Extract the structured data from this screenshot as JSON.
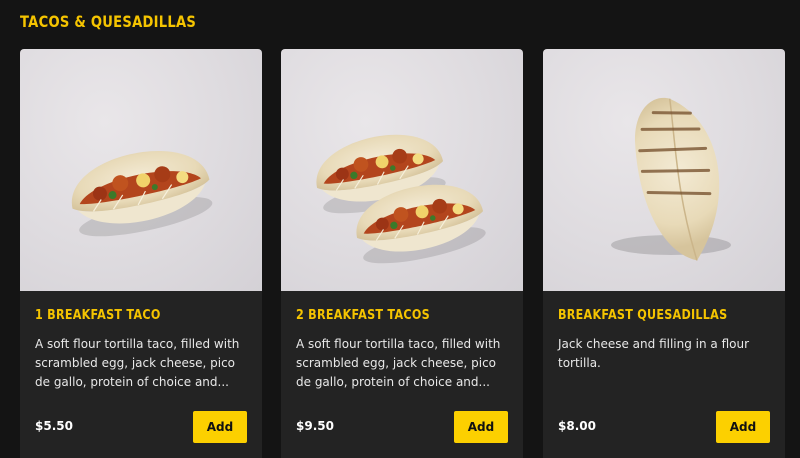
{
  "section": {
    "title": "TACOS & QUESADILLAS"
  },
  "colors": {
    "accent": "#f5c400",
    "button": "#fcd000",
    "card_bg": "#232323",
    "page_bg": "#141414"
  },
  "items": [
    {
      "name": "1 BREAKFAST TACO",
      "description": "A soft flour tortilla taco, filled with scrambled egg, jack cheese, pico de gallo, protein of choice and...",
      "price": "$5.50",
      "add_label": "Add",
      "image": "single-taco-photo"
    },
    {
      "name": "2 BREAKFAST TACOS",
      "description": "A soft flour tortilla taco, filled with scrambled egg, jack cheese, pico de gallo, protein of choice and...",
      "price": "$9.50",
      "add_label": "Add",
      "image": "two-tacos-photo"
    },
    {
      "name": "BREAKFAST QUESADILLAS",
      "description": "Jack cheese and filling in a flour tortilla.",
      "price": "$8.00",
      "add_label": "Add",
      "image": "quesadilla-photo"
    }
  ]
}
